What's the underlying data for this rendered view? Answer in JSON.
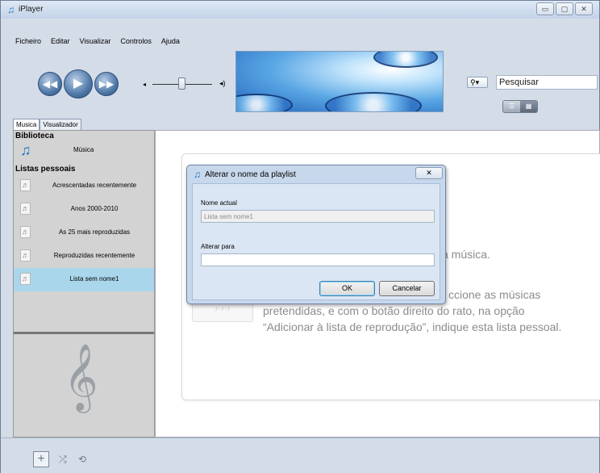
{
  "window": {
    "title": "iPlayer",
    "controls": [
      "▭",
      "▢",
      "✕"
    ]
  },
  "menu": [
    "Ficheiro",
    "Editar",
    "Visualizar",
    "Controlos",
    "Ajuda"
  ],
  "search": {
    "placeholder": "Pesquisar",
    "value": "Pesquisar"
  },
  "tabs": [
    {
      "label": "Musica",
      "active": true
    },
    {
      "label": "Visualizador",
      "active": false
    }
  ],
  "sidebar": {
    "library_header": "Biblioteca",
    "music_label": "Música",
    "playlists_header": "Listas pessoais",
    "playlists": [
      {
        "label": "Acrescentadas recentemente"
      },
      {
        "label": "Anos 2000-2010"
      },
      {
        "label": "As 25 mais reproduzidas"
      },
      {
        "label": "Reproduzidas recentemente"
      },
      {
        "label": "Lista sem nome1",
        "selected": true
      }
    ]
  },
  "content": {
    "hint_line1": "a música.",
    "hint_line2": "ccione as músicas",
    "hint_line3": "pretendidas, e com o botão direito do rato, na opção",
    "hint_line4": "“Adicionar à lista de reprodução”, indique esta lista pessoal."
  },
  "dialog": {
    "title": "Alterar o nome da playlist",
    "current_name_label": "Nome actual",
    "current_name_value": "Lista sem nome1",
    "new_name_label": "Alterar para",
    "new_name_value": "",
    "ok_label": "OK",
    "cancel_label": "Cancelar"
  },
  "icons": {
    "app": "music-note-icon",
    "search": "magnifier-icon",
    "add": "plus-icon",
    "shuffle": "shuffle-icon",
    "repeat": "repeat-icon",
    "clef": "treble-clef-icon"
  },
  "colors": {
    "accent": "#1e73c8",
    "selection": "#aad6ec",
    "chrome": "#d4dce8"
  }
}
